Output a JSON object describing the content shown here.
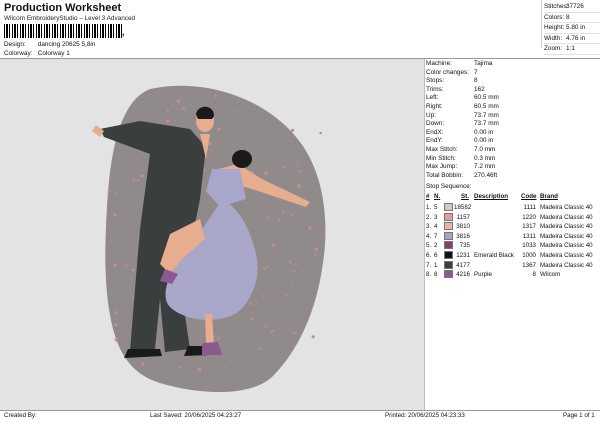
{
  "header": {
    "title": "Production Worksheet",
    "subtitle": "Wilcom EmbroideryStudio – Level 3 Advanced",
    "design_label": "Design:",
    "design_value": "dancing 20625 5,8in",
    "colorway_label": "Colorway:",
    "colorway_value": "Colorway 1",
    "barcode_suffix": ","
  },
  "top_stats": [
    {
      "label": "Stitches:",
      "value": "37726"
    },
    {
      "label": "Colors:",
      "value": "8"
    },
    {
      "label": "Height:",
      "value": "5.80 in"
    },
    {
      "label": "Width:",
      "value": "4.76 in"
    },
    {
      "label": "Zoom:",
      "value": "1:1"
    }
  ],
  "machine_info": [
    {
      "label": "Machine:",
      "value": "Tajima"
    },
    {
      "label": "Color changes:",
      "value": "7"
    },
    {
      "label": "Stops:",
      "value": "8"
    },
    {
      "label": "Trims:",
      "value": "162"
    },
    {
      "label": "Left:",
      "value": "60.5 mm"
    },
    {
      "label": "Right:",
      "value": "60.5 mm"
    },
    {
      "label": "Up:",
      "value": "73.7 mm"
    },
    {
      "label": "Down:",
      "value": "73.7 mm"
    },
    {
      "label": "EndX:",
      "value": "0.00 in"
    },
    {
      "label": "EndY:",
      "value": "0.00 in"
    },
    {
      "label": "Max Stitch:",
      "value": "7.0 mm"
    },
    {
      "label": "Min Stitch:",
      "value": "0.3 mm"
    },
    {
      "label": "Max Jump:",
      "value": "7.2 mm"
    },
    {
      "label": "Total Bobbin:",
      "value": "270.46ft"
    }
  ],
  "stop_sequence": {
    "heading": "Stop Sequence:",
    "columns": {
      "num": "#",
      "n": "N.",
      "st": "St.",
      "description": "Description",
      "code": "Code",
      "brand": "Brand"
    },
    "rows": [
      {
        "num": "1.",
        "n": "5",
        "color": "#d9c3c4",
        "st": "18582",
        "description": "",
        "code": "1111",
        "brand": "Madeira Classic 40"
      },
      {
        "num": "2.",
        "n": "3",
        "color": "#e39b9f",
        "st": "1157",
        "description": "",
        "code": "1220",
        "brand": "Madeira Classic 40"
      },
      {
        "num": "3.",
        "n": "4",
        "color": "#e8b6a2",
        "st": "3810",
        "description": "",
        "code": "1317",
        "brand": "Madeira Classic 40"
      },
      {
        "num": "4.",
        "n": "7",
        "color": "#a7a2c8",
        "st": "3816",
        "description": "",
        "code": "1311",
        "brand": "Madeira Classic 40"
      },
      {
        "num": "5.",
        "n": "2",
        "color": "#8a3e70",
        "st": "735",
        "description": "",
        "code": "1033",
        "brand": "Madeira Classic 40"
      },
      {
        "num": "6.",
        "n": "6",
        "color": "#111111",
        "st": "1231",
        "description": "Emerald Black",
        "code": "1000",
        "brand": "Madeira Classic 40"
      },
      {
        "num": "7.",
        "n": "1",
        "color": "#3c3f3f",
        "st": "4177",
        "description": "",
        "code": "1367",
        "brand": "Madeira Classic 40"
      },
      {
        "num": "8.",
        "n": "8",
        "color": "#8b5a8e",
        "st": "4216",
        "description": "Purple",
        "code": "8",
        "brand": "Wilcom"
      }
    ]
  },
  "footer": {
    "created_by": "Created By:",
    "last_saved": "Last Saved: 20/06/2025 04:23:27",
    "printed": "Printed: 20/06/2025 04:23:33",
    "page": "Page 1 of 1"
  },
  "colors": {
    "background_fabric": "#e3e3e3",
    "backdrop_shape": "#8d8787",
    "suit": "#3b3e3f",
    "dress": "#a9a6cc",
    "skin": "#e6ad8e",
    "sparkles": "#c9879a"
  }
}
